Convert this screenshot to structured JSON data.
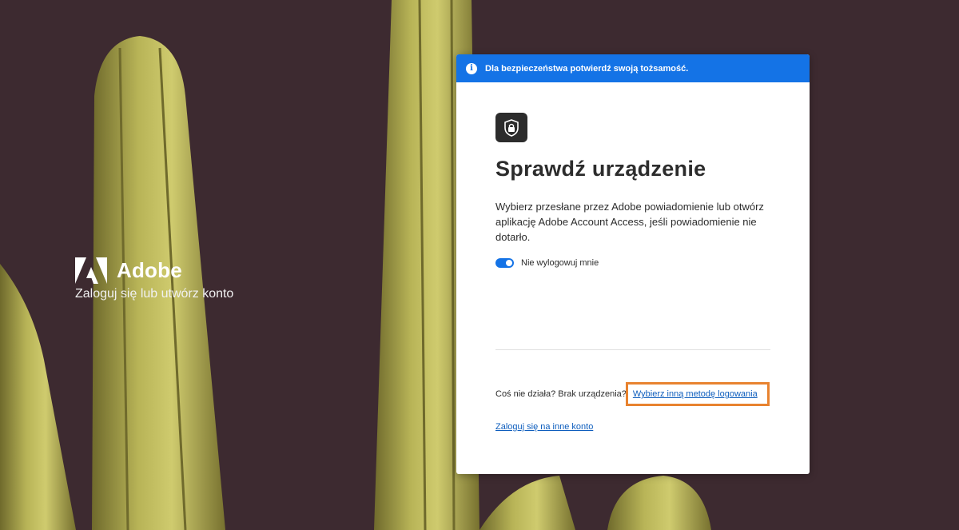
{
  "brand": {
    "name": "Adobe",
    "tagline": "Zaloguj się lub utwórz konto",
    "logo_icon": "adobe-logo-icon"
  },
  "card": {
    "banner_text": "Dla bezpieczeństwa potwierdź swoją tożsamość.",
    "banner_icon": "info-icon",
    "device_icon": "device-lock-icon",
    "title": "Sprawdź urządzenie",
    "description": "Wybierz przesłane przez Adobe powiadomienie lub otwórz aplikację Adobe Account Access, jeśli powiadomienie nie dotarło.",
    "stay_signed_in_label": "Nie wylogowuj mnie",
    "help_text": "Coś nie działa? Brak urządzenia?",
    "other_method_link": "Wybierz inną metodę logowania",
    "other_account_link": "Zaloguj się na inne konto"
  },
  "colors": {
    "accent": "#1473e6",
    "link": "#0d5dbd",
    "highlight": "#e8832f",
    "background": "#3d2a30"
  }
}
